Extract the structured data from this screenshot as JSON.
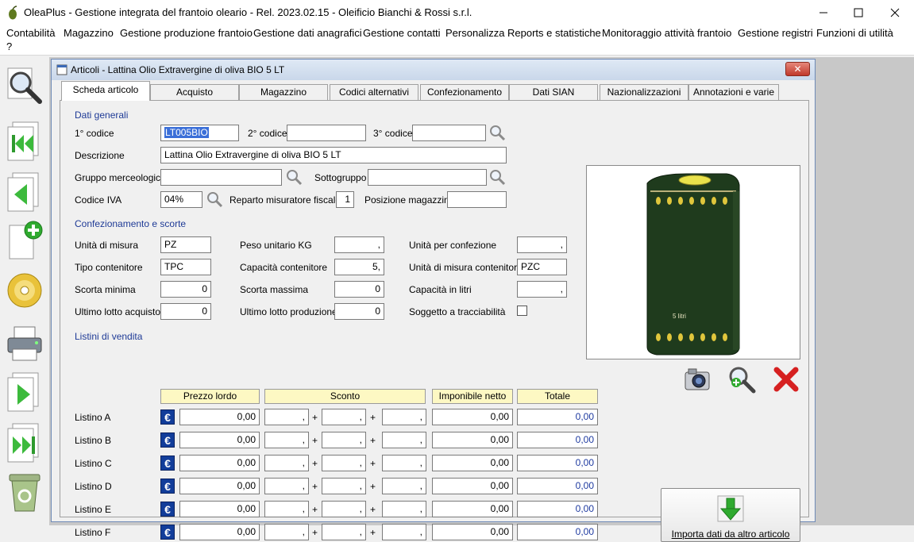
{
  "app": {
    "title": "OleaPlus - Gestione integrata del frantoio oleario - Rel. 2023.02.15 - Oleificio Bianchi & Rossi s.r.l.",
    "minimize": "—",
    "maximize": "☐",
    "close": "✕"
  },
  "menu": [
    "Contabilità",
    "Magazzino",
    "Gestione produzione frantoio",
    "Gestione dati anagrafici",
    "Gestione contatti",
    "Personalizza",
    "Reports e statistiche",
    "Monitoraggio attività frantoio",
    "Gestione registri",
    "Funzioni di utilità",
    "?"
  ],
  "window": {
    "title": "Articoli - Lattina Olio Extravergine di oliva BIO 5 LT",
    "close": "✕"
  },
  "tabs": [
    "Scheda articolo",
    "Acquisto",
    "Magazzino",
    "Codici alternativi",
    "Confezionamento",
    "Dati SIAN",
    "Nazionalizzazioni",
    "Annotazioni e varie"
  ],
  "general": {
    "section": "Dati generali",
    "code1_label": "1° codice",
    "code1": "LT005BIO",
    "code2_label": "2° codice",
    "code2": "",
    "code3_label": "3° codice",
    "code3": "",
    "desc_label": "Descrizione",
    "desc": "Lattina Olio Extravergine di oliva BIO 5 LT",
    "group_label": "Gruppo merceologico",
    "group": "",
    "subgroup_label": "Sottogruppo",
    "subgroup": "",
    "iva_label": "Codice IVA",
    "iva": "04%",
    "reparto_label": "Reparto misuratore fiscale",
    "reparto": "1",
    "posizione_label": "Posizione magazzino",
    "posizione": ""
  },
  "packaging": {
    "section": "Confezionamento e scorte",
    "um_label": "Unità di misura",
    "um": "PZ",
    "peso_label": "Peso unitario KG",
    "peso": ",",
    "upc_label": "Unità per confezione",
    "upc": ",",
    "tipo_label": "Tipo contenitore",
    "tipo": "TPC",
    "cap_label": "Capacità contenitore",
    "cap": "5,",
    "umc_label": "Unità di misura contenitore",
    "umc": "PZC",
    "smin_label": "Scorta minima",
    "smin": "0",
    "smax_label": "Scorta massima",
    "smax": "0",
    "caplitri_label": "Capacità in litri",
    "caplitri": ",",
    "ula_label": "Ultimo lotto acquisto",
    "ula": "0",
    "ulp_label": "Ultimo lotto produzione",
    "ulp": "0",
    "tracc_label": "Soggetto a tracciabilità"
  },
  "prices": {
    "section": "Listini di vendita",
    "headers": {
      "lordo": "Prezzo lordo",
      "sconto": "Sconto",
      "imponibile": "Imponibile netto",
      "totale": "Totale"
    },
    "currency": "€",
    "plus": "+",
    "rows": [
      {
        "name": "Listino A",
        "lordo": "0,00",
        "s1": ",",
        "s2": ",",
        "s3": ",",
        "imponibile": "0,00",
        "totale": "0,00"
      },
      {
        "name": "Listino B",
        "lordo": "0,00",
        "s1": ",",
        "s2": ",",
        "s3": ",",
        "imponibile": "0,00",
        "totale": "0,00"
      },
      {
        "name": "Listino C",
        "lordo": "0,00",
        "s1": ",",
        "s2": ",",
        "s3": ",",
        "imponibile": "0,00",
        "totale": "0,00"
      },
      {
        "name": "Listino D",
        "lordo": "0,00",
        "s1": ",",
        "s2": ",",
        "s3": ",",
        "imponibile": "0,00",
        "totale": "0,00"
      },
      {
        "name": "Listino E",
        "lordo": "0,00",
        "s1": ",",
        "s2": ",",
        "s3": ",",
        "imponibile": "0,00",
        "totale": "0,00"
      },
      {
        "name": "Listino F",
        "lordo": "0,00",
        "s1": ",",
        "s2": ",",
        "s3": ",",
        "imponibile": "0,00",
        "totale": "0,00"
      }
    ]
  },
  "product_image": {
    "can_label": "5 litri"
  },
  "import_button": "Importa dati da altro articolo"
}
